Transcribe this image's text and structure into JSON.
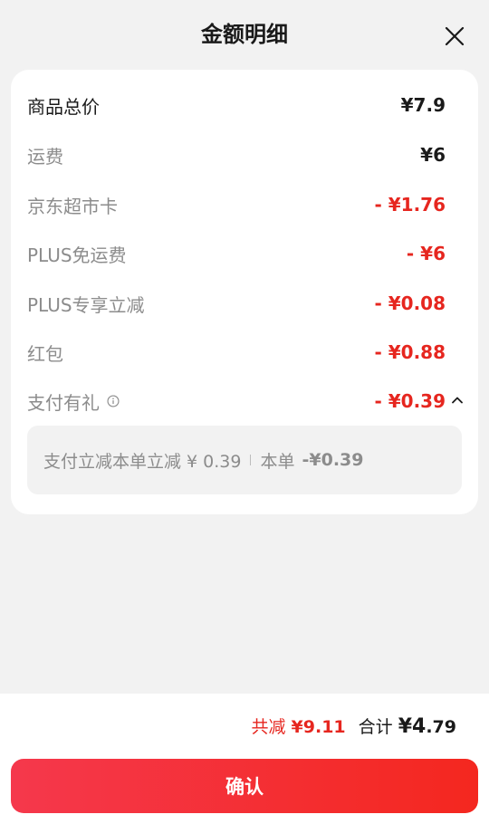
{
  "header": {
    "title": "金额明细",
    "close_icon": "close-icon"
  },
  "rows": [
    {
      "label": "商品总价",
      "value": "¥7.9"
    },
    {
      "label": "运费",
      "value": "¥6"
    },
    {
      "label": "京东超市卡",
      "value": "- ¥1.76"
    },
    {
      "label": "PLUS免运费",
      "value": "- ¥6"
    },
    {
      "label": "PLUS专享立减",
      "value": "- ¥0.08"
    },
    {
      "label": "红包",
      "value": "- ¥0.88"
    },
    {
      "label": "支付有礼",
      "value": "- ¥0.39"
    }
  ],
  "pay_gift_detail": {
    "text": "支付立减本单立减 ¥ 0.39",
    "order_label": "本单",
    "order_value": "-¥0.39"
  },
  "footer": {
    "reduce_label": "共减",
    "reduce_value": "¥9.11",
    "total_label": "合计",
    "total_symbol": "¥",
    "total_int": "4",
    "total_dec": ".79",
    "confirm_label": "确认"
  },
  "colors": {
    "accent_red": "#e6261f",
    "button_start": "#f5384c",
    "button_end": "#f4271f"
  }
}
